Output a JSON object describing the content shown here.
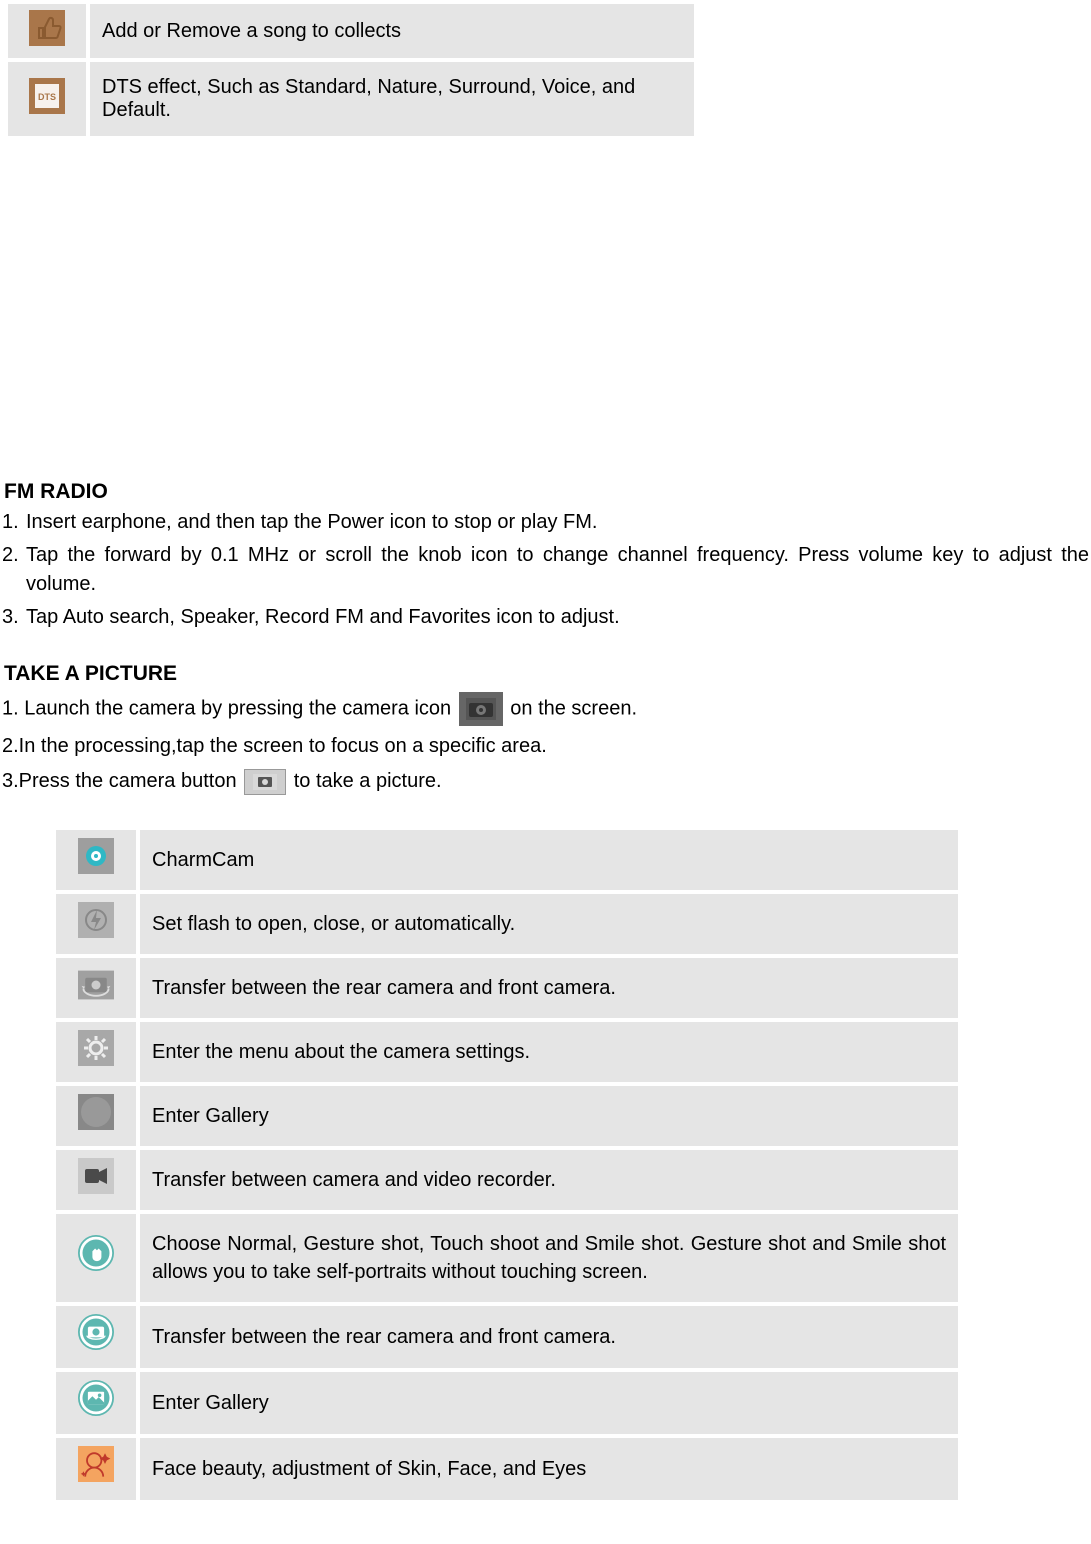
{
  "top_rows": [
    {
      "icon": "thumbs-up-icon",
      "desc": "Add or Remove a song to collects"
    },
    {
      "icon": "dts-icon",
      "desc": "DTS effect, Such as Standard, Nature, Surround, Voice, and Default."
    }
  ],
  "fm": {
    "heading": "FM RADIO",
    "items": [
      "Insert earphone, and then tap the Power icon to stop or play FM.",
      "Tap the forward by 0.1 MHz or scroll the knob icon to change channel frequency. Press volume key to adjust the volume.",
      "Tap Auto search, Speaker, Record FM and Favorites icon to adjust."
    ]
  },
  "picture": {
    "heading": "TAKE A PICTURE",
    "step1_pre": "1. Launch the camera by pressing the camera icon ",
    "step1_post": "on the screen.",
    "step2": "2.In the processing,tap the screen to focus on a specific area.",
    "step3_pre": "3.Press the camera button",
    "step3_post": " to take a picture."
  },
  "camera_rows": [
    {
      "icon": "charmcam-icon",
      "desc": "CharmCam"
    },
    {
      "icon": "flash-icon",
      "desc": "Set flash to open, close, or automatically."
    },
    {
      "icon": "switch-camera-icon",
      "desc": "Transfer between the rear camera and front camera."
    },
    {
      "icon": "settings-gear-icon",
      "desc": "Enter the menu about the camera settings."
    },
    {
      "icon": "gallery-gray-icon",
      "desc": "Enter Gallery"
    },
    {
      "icon": "video-recorder-icon",
      "desc": "Transfer between camera and video recorder."
    },
    {
      "icon": "gesture-shot-icon",
      "desc": "Choose Normal, Gesture shot, Touch shoot and Smile shot. Gesture shot and Smile shot allows you to take self-portraits without touching screen."
    },
    {
      "icon": "switch-camera-teal-icon",
      "desc": "Transfer between the rear camera and front camera."
    },
    {
      "icon": "gallery-teal-icon",
      "desc": "Enter Gallery"
    },
    {
      "icon": "face-beauty-icon",
      "desc": "Face beauty, adjustment of Skin, Face, and Eyes"
    }
  ]
}
